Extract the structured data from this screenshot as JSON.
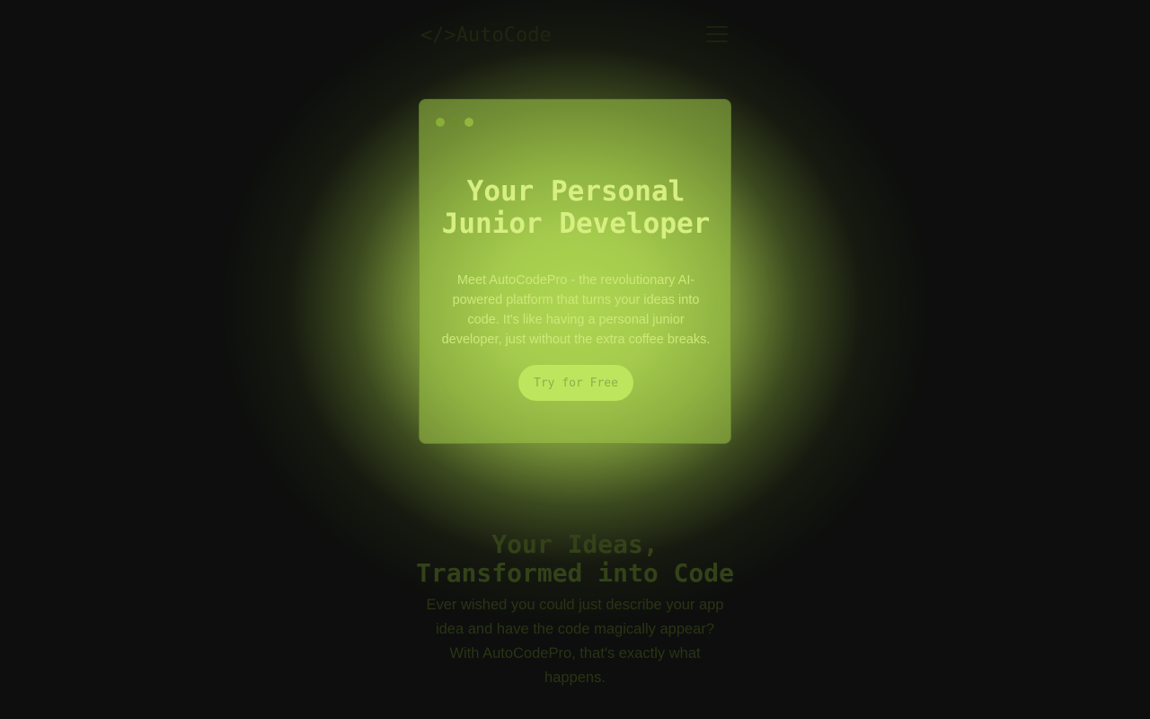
{
  "nav": {
    "logo": "</>AutoCode",
    "menu_icon": "hamburger-menu-icon"
  },
  "hero": {
    "window_dots": [
      "red",
      "yellow",
      "green"
    ],
    "title_line1": "Your Personal",
    "title_line2": "Junior Developer",
    "description": "Meet AutoCodePro - the revolutionary AI-powered platform that turns your ideas into code. It's like having a personal junior developer, just without the extra coffee breaks.",
    "cta_label": "Try for Free"
  },
  "features": {
    "title_line1": "Your Ideas,",
    "title_line2": "Transformed into Code",
    "description": "Ever wished you could just describe your app idea and have the code magically appear? With AutoCodePro, that's exactly what happens."
  },
  "colors": {
    "accent": "#bde65e",
    "background": "#0d0e0d"
  }
}
